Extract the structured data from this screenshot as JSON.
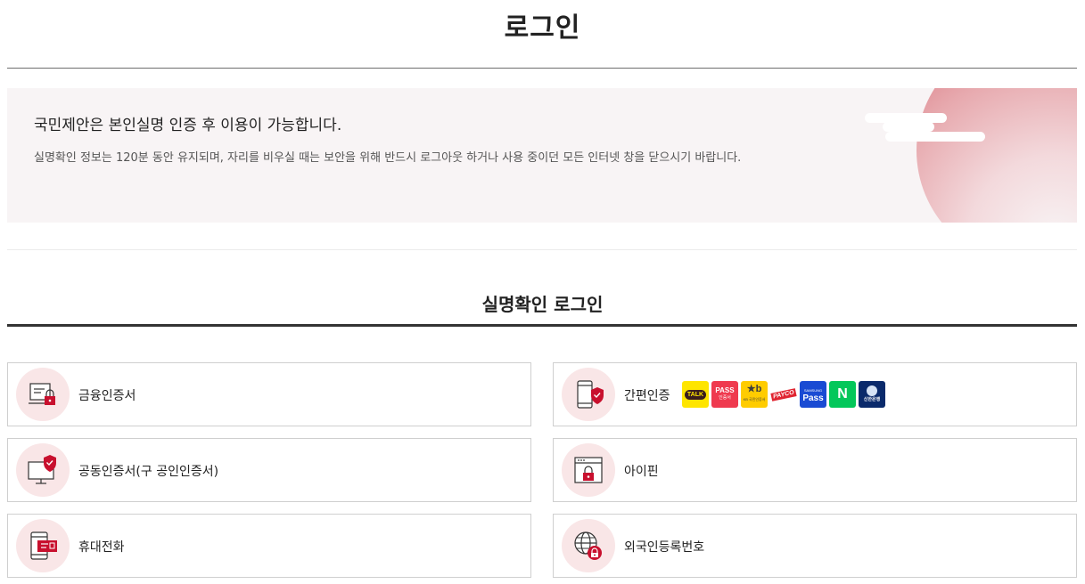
{
  "page": {
    "title": "로그인"
  },
  "notice": {
    "heading": "국민제안은 본인실명 인증 후 이용이 가능합니다.",
    "text": "실명확인 정보는 120분 동안 유지되며, 자리를 비우실 때는 보안을 위해 반드시 로그아웃 하거나 사용 중이던 모든 인터넷 창을 닫으시기 바랍니다."
  },
  "section": {
    "title": "실명확인 로그인"
  },
  "login_methods": [
    {
      "label": "금융인증서",
      "icon": "certificate-lock-icon"
    },
    {
      "label": "간편인증",
      "icon": "mobile-shield-icon"
    },
    {
      "label": "공동인증서(구 공인인증서)",
      "icon": "monitor-shield-icon"
    },
    {
      "label": "아이핀",
      "icon": "browser-lock-icon"
    },
    {
      "label": "휴대전화",
      "icon": "mobile-card-icon"
    },
    {
      "label": "외국인등록번호",
      "icon": "globe-lock-icon"
    }
  ],
  "simple_auth_providers": [
    {
      "name": "kakao",
      "text": "TALK"
    },
    {
      "name": "pass",
      "text": "PASS",
      "subtext": "인증서"
    },
    {
      "name": "kb",
      "text": "★b",
      "subtext": "KB 국민인증서"
    },
    {
      "name": "payco",
      "text": "PAYCO"
    },
    {
      "name": "samsung-pass",
      "text": "Pass",
      "subtext": "SAMSUNG"
    },
    {
      "name": "naver",
      "text": "N"
    },
    {
      "name": "shinhan",
      "text": "신한은행"
    }
  ],
  "colors": {
    "accent": "#c8102e",
    "icon_bg": "#f9e6e7",
    "notice_bg": "#f8f4f5"
  }
}
